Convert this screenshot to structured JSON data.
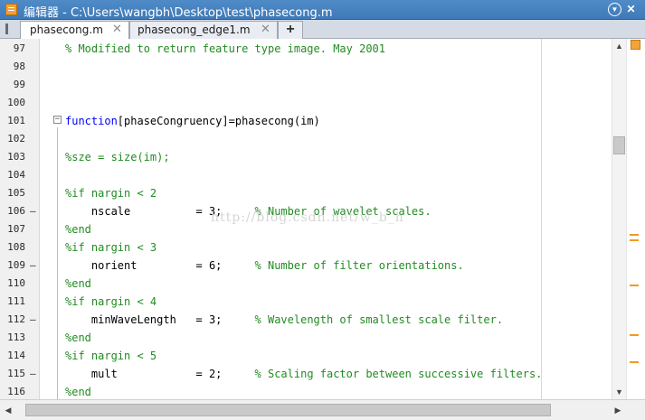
{
  "window": {
    "title": "编辑器 - C:\\Users\\wangbh\\Desktop\\test\\phasecong.m",
    "menu_glyph": "▼",
    "close_glyph": "✕"
  },
  "tabs": [
    {
      "label": "phasecong.m",
      "close": "✕",
      "active": true
    },
    {
      "label": "phasecong_edge1.m",
      "close": "✕",
      "active": false
    }
  ],
  "add_tab_glyph": "+",
  "fold_toggle": "−",
  "watermark": "http://blog.csdn.net/w_b_h",
  "lines": [
    {
      "num": "97",
      "dash": "",
      "text": "% Modified to return feature type image. May 2001"
    },
    {
      "num": "98",
      "dash": "",
      "text": ""
    },
    {
      "num": "99",
      "dash": "",
      "text": ""
    },
    {
      "num": "100",
      "dash": "",
      "text": ""
    },
    {
      "num": "101",
      "dash": "",
      "kw": "function",
      "text": "[phaseCongruency]=phasecong(im)"
    },
    {
      "num": "102",
      "dash": "",
      "text": ""
    },
    {
      "num": "103",
      "dash": "",
      "text": "%sze = size(im);"
    },
    {
      "num": "104",
      "dash": "",
      "text": ""
    },
    {
      "num": "105",
      "dash": "",
      "text": "%if nargin < 2"
    },
    {
      "num": "106",
      "dash": "—",
      "text": "    nscale          = 3;     ",
      "comment": "% Number of wavelet scales."
    },
    {
      "num": "107",
      "dash": "",
      "text": "%end"
    },
    {
      "num": "108",
      "dash": "",
      "text": "%if nargin < 3"
    },
    {
      "num": "109",
      "dash": "—",
      "text": "    norient         = 6;     ",
      "comment": "% Number of filter orientations."
    },
    {
      "num": "110",
      "dash": "",
      "text": "%end"
    },
    {
      "num": "111",
      "dash": "",
      "text": "%if nargin < 4"
    },
    {
      "num": "112",
      "dash": "—",
      "text": "    minWaveLength   = 3;     ",
      "comment": "% Wavelength of smallest scale filter."
    },
    {
      "num": "113",
      "dash": "",
      "text": "%end"
    },
    {
      "num": "114",
      "dash": "",
      "text": "%if nargin < 5"
    },
    {
      "num": "115",
      "dash": "—",
      "text": "    mult            = 2;     ",
      "comment": "% Scaling factor between successive filters."
    },
    {
      "num": "116",
      "dash": "",
      "text": "%end"
    }
  ],
  "scroll_arrows": {
    "up": "▲",
    "down": "▼",
    "left": "◀",
    "right": "▶"
  },
  "colors": {
    "comment": "#228b22",
    "keyword": "#0000ff",
    "title_bar": "#3f7ab8",
    "warning_marker": "#f29a1d"
  }
}
